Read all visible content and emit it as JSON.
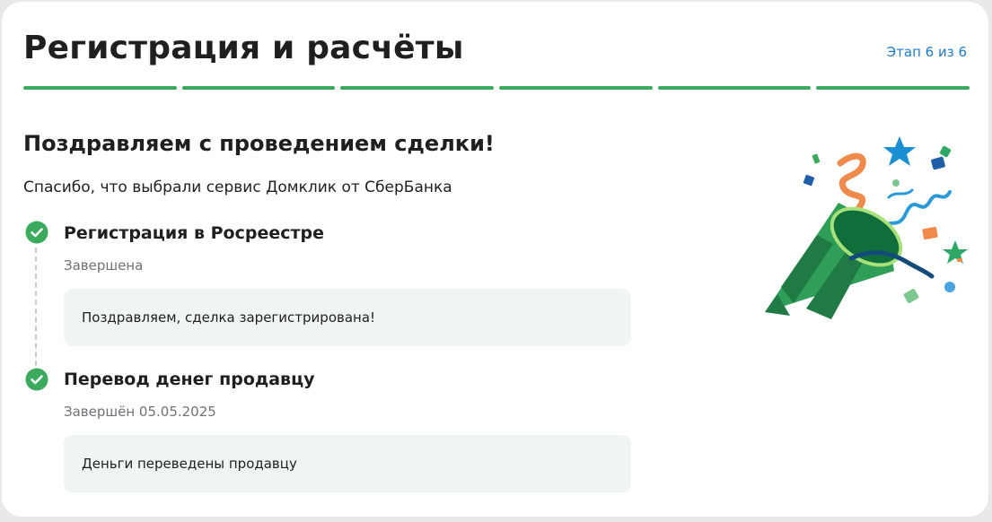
{
  "header": {
    "title": "Регистрация и расчёты",
    "step_counter": "Этап 6 из 6",
    "progress": {
      "total_steps": 6,
      "completed_steps": 6,
      "color": "#3aaa5c"
    }
  },
  "congrats": {
    "title": "Поздравляем с проведением сделки!",
    "subtitle": "Спасибо, что выбрали сервис Домклик от СберБанка",
    "illustration_icon": "party-popper-icon"
  },
  "steps": [
    {
      "title": "Регистрация в Росреестре",
      "status": "Завершена",
      "note": "Поздравляем, сделка зарегистрирована!",
      "icon": "check-circle-icon"
    },
    {
      "title": "Перевод денег продавцу",
      "status": "Завершён 05.05.2025",
      "note": "Деньги переведены продавцу",
      "icon": "check-circle-icon"
    }
  ],
  "colors": {
    "accent_green": "#3aaa5c",
    "link_blue": "#1f7ac7",
    "note_background": "#eff6f1"
  }
}
